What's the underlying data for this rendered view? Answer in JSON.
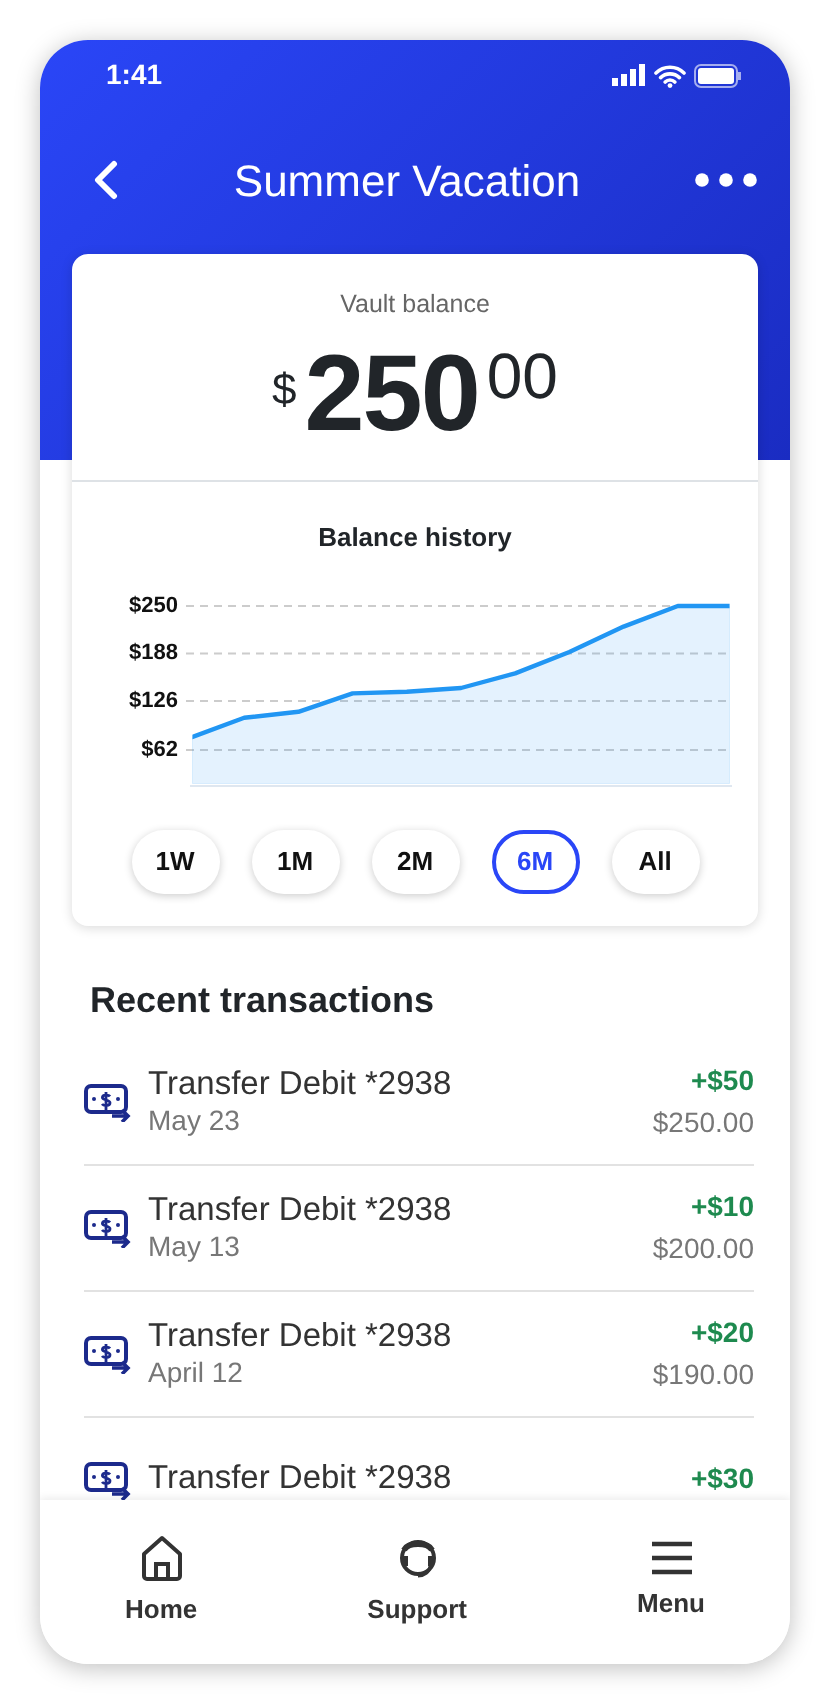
{
  "status_bar": {
    "time": "1:41"
  },
  "header": {
    "title": "Summer Vacation"
  },
  "balance_card": {
    "label": "Vault balance",
    "currency": "$",
    "whole": "250",
    "cents": "00"
  },
  "balance_history": {
    "title": "Balance history",
    "chart_data": {
      "type": "area",
      "grid": true,
      "ylim": [
        15,
        250
      ],
      "series": [
        {
          "color": "#2196f3",
          "values": [
            78,
            104,
            112,
            136,
            138,
            143,
            162,
            190,
            223,
            250,
            250
          ]
        }
      ],
      "yticks": [
        {
          "value": 62,
          "label": "$62"
        },
        {
          "value": 126,
          "label": "$126"
        },
        {
          "value": 188,
          "label": "$188"
        },
        {
          "value": 250,
          "label": "$250"
        }
      ]
    },
    "ranges": [
      {
        "label": "1W",
        "selected": false
      },
      {
        "label": "1M",
        "selected": false
      },
      {
        "label": "2M",
        "selected": false
      },
      {
        "label": "6M",
        "selected": true
      },
      {
        "label": "All",
        "selected": false
      }
    ]
  },
  "recent_transactions": {
    "title": "Recent transactions",
    "items": [
      {
        "name": "Transfer Debit *2938",
        "date": "May 23",
        "amount": "+$50",
        "balance": "$250.00"
      },
      {
        "name": "Transfer Debit *2938",
        "date": "May 13",
        "amount": "+$10",
        "balance": "$200.00"
      },
      {
        "name": "Transfer Debit *2938",
        "date": "April 12",
        "amount": "+$20",
        "balance": "$190.00"
      },
      {
        "name": "Transfer Debit *2938",
        "amount": "+$30"
      }
    ]
  },
  "bottom_nav": [
    {
      "kind": "home",
      "label": "Home"
    },
    {
      "kind": "support",
      "label": "Support"
    },
    {
      "kind": "menu",
      "label": "Menu"
    }
  ]
}
